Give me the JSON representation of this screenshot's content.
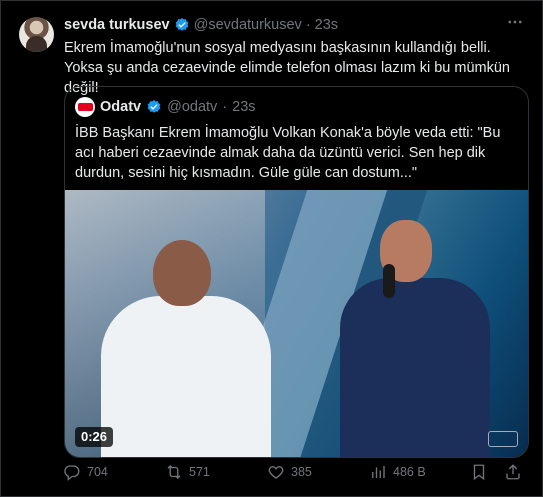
{
  "tweet": {
    "name": "sevda turkusev",
    "handle": "@sevdaturkusev",
    "separator": "·",
    "time": "23s",
    "text": "Ekrem İmamoğlu'nun sosyal medyasını başkasının kullandığı belli. Yoksa şu anda cezaevinde elimde telefon olması lazım ki bu mümkün değil!",
    "more_icon": "more-icon",
    "verified_color": "#1d9bf0"
  },
  "quote": {
    "name": "Odatv",
    "handle": "@odatv",
    "separator": "·",
    "time": "23s",
    "text": "İBB Başkanı Ekrem İmamoğlu Volkan Konak'a böyle veda etti: \"Bu acı haberi cezaevinde almak daha da üzüntü verici. Sen hep dik durdun, sesini hiç kısmadın. Güle güle can dostum...\"",
    "video_duration": "0:26",
    "logo_color": "#e2001a"
  },
  "actions": {
    "reply_count": "704",
    "retweet_count": "571",
    "like_count": "385",
    "views_count": "486 B"
  },
  "colors": {
    "background": "#000000",
    "text": "#e7e9ea",
    "muted": "#71767b",
    "border": "#2f3336",
    "accent": "#1d9bf0"
  }
}
